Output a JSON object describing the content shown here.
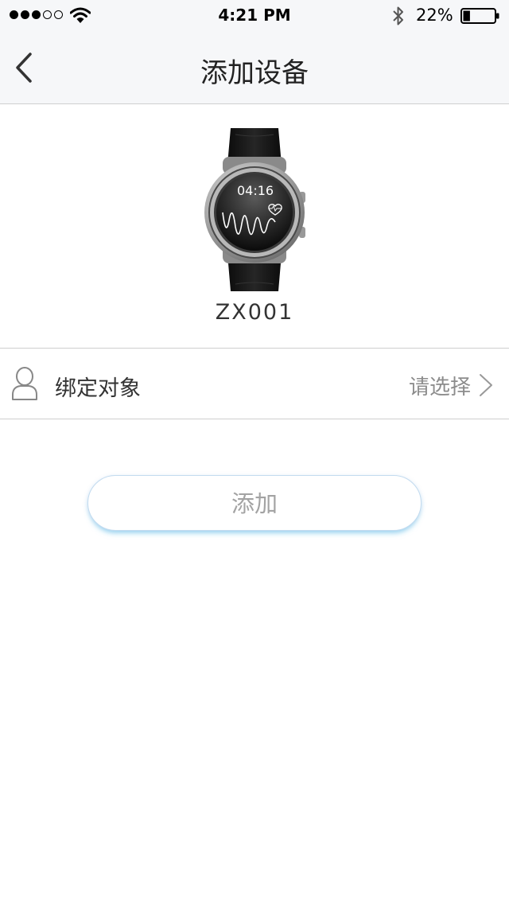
{
  "status_bar": {
    "signal_icon": "signal-dots-icon",
    "time": "4:21 PM",
    "battery_percent": "22%",
    "battery_level": 0.22
  },
  "nav": {
    "title": "添加设备",
    "back_icon": "chevron-left-icon"
  },
  "device": {
    "name": "ZX001",
    "watch_time": "04:16",
    "image_icon": "smartwatch-image"
  },
  "bind_row": {
    "label": "绑定对象",
    "value": "请选择",
    "icon": "person-icon"
  },
  "actions": {
    "add_label": "添加"
  },
  "colors": {
    "nav_background": "#f6f7f9",
    "divider": "#cfcfcf",
    "button_border": "#c3dbef",
    "button_glow": "#50c8f0"
  }
}
